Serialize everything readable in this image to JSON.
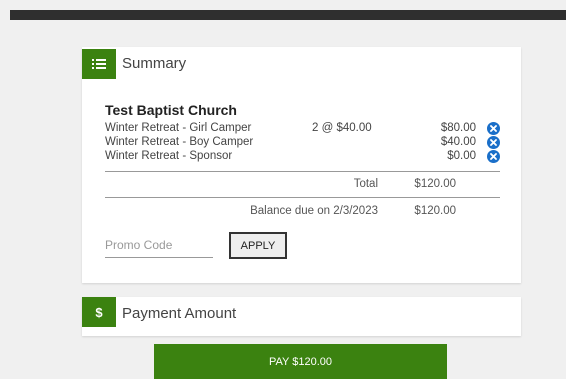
{
  "colors": {
    "accent": "#3b8210",
    "remove_icon": "#1a6fc9"
  },
  "summary": {
    "title": "Summary",
    "icon": "list-icon",
    "org_name": "Test Baptist Church",
    "items": [
      {
        "description": "Winter Retreat - Girl Camper",
        "quantity": "2 @ $40.00",
        "amount": "$80.00"
      },
      {
        "description": "Winter Retreat - Boy Camper",
        "quantity": "",
        "amount": "$40.00"
      },
      {
        "description": "Winter Retreat - Sponsor",
        "quantity": "",
        "amount": "$0.00"
      }
    ],
    "total_label": "Total",
    "total_value": "$120.00",
    "balance_label": "Balance due on 2/3/2023",
    "balance_value": "$120.00",
    "promo_placeholder": "Promo Code",
    "promo_value": "",
    "apply_label": "APPLY"
  },
  "payment": {
    "title": "Payment Amount",
    "icon": "dollar-icon"
  },
  "pay_button_label": "PAY $120.00"
}
